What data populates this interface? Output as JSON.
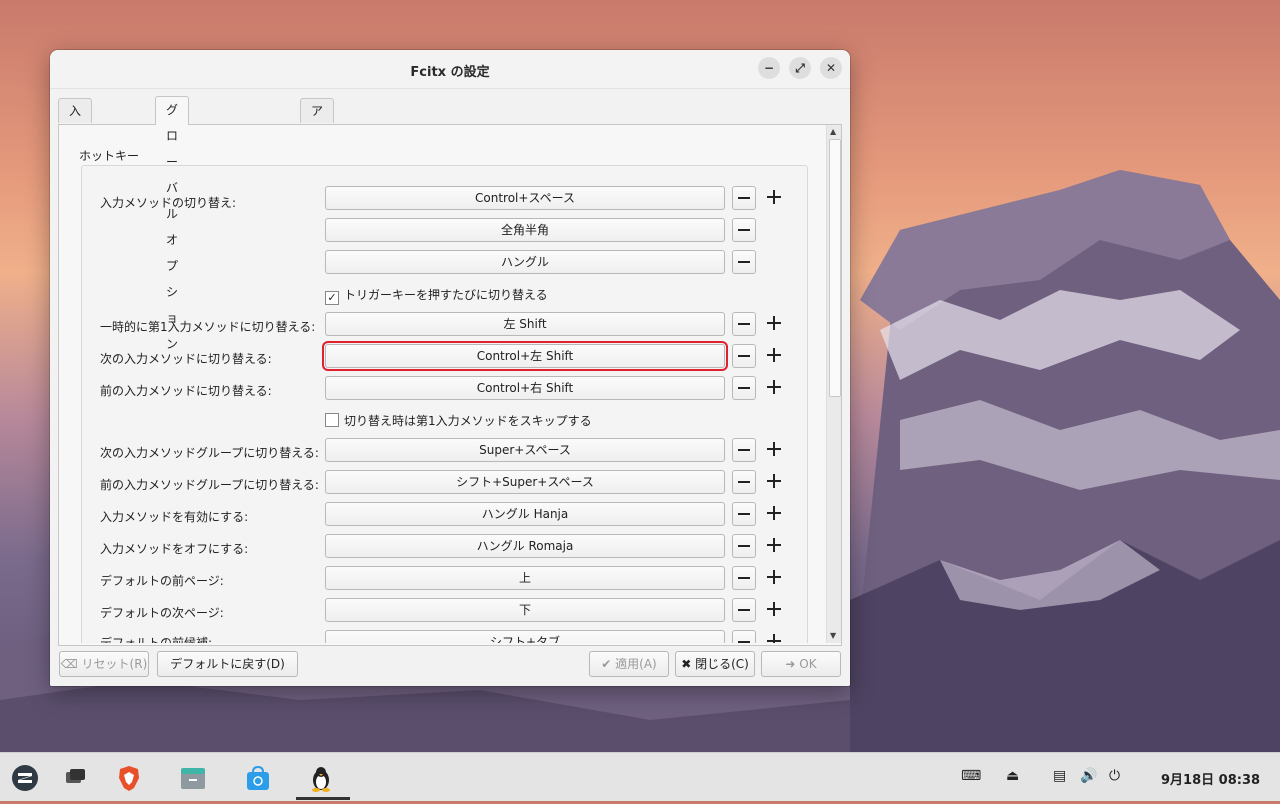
{
  "window": {
    "title": "Fcitx の設定",
    "controls": {
      "minimize": "−",
      "maximize": "⤢",
      "close": "✕"
    }
  },
  "tabs": [
    {
      "label": "入力メソッド"
    },
    {
      "label": "グローバルオプション"
    },
    {
      "label": "アドオン"
    }
  ],
  "group_label": "ホットキー",
  "rows": {
    "switch_label": "入力メソッドの切り替え:",
    "switch_keys": [
      "Control+スペース",
      "全角半角",
      "ハングル"
    ],
    "trigger_check": {
      "label": "トリガーキーを押すたびに切り替える",
      "checked_mark": "✓"
    },
    "temp_label": "一時的に第1入力メソッドに切り替える:",
    "temp_key": "左 Shift",
    "next_label": "次の入力メソッドに切り替える:",
    "next_key": "Control+左 Shift",
    "prev_label": "前の入力メソッドに切り替える:",
    "prev_key": "Control+右 Shift",
    "skip_check": {
      "label": "切り替え時は第1入力メソッドをスキップする"
    },
    "next_group_label": "次の入力メソッドグループに切り替える:",
    "next_group_key": "Super+スペース",
    "prev_group_label": "前の入力メソッドグループに切り替える:",
    "prev_group_key": "シフト+Super+スペース",
    "enable_label": "入力メソッドを有効にする:",
    "enable_key": "ハングル Hanja",
    "off_label": "入力メソッドをオフにする:",
    "off_key": "ハングル Romaja",
    "prev_page_label": "デフォルトの前ページ:",
    "prev_page_key": "上",
    "next_page_label": "デフォルトの次ページ:",
    "next_page_key": "下",
    "prev_cand_label": "デフォルトの前候補:",
    "prev_cand_key": "シフト+タブ"
  },
  "buttons": {
    "reset": "リセット(R)",
    "defaults": "デフォルトに戻す(D)",
    "apply": "適用(A)",
    "close": "閉じる(C)",
    "ok": "OK"
  },
  "taskbar": {
    "clock_date": "9月18日",
    "clock_time": "08:38"
  },
  "colors": {
    "highlight": "#e0202c"
  }
}
